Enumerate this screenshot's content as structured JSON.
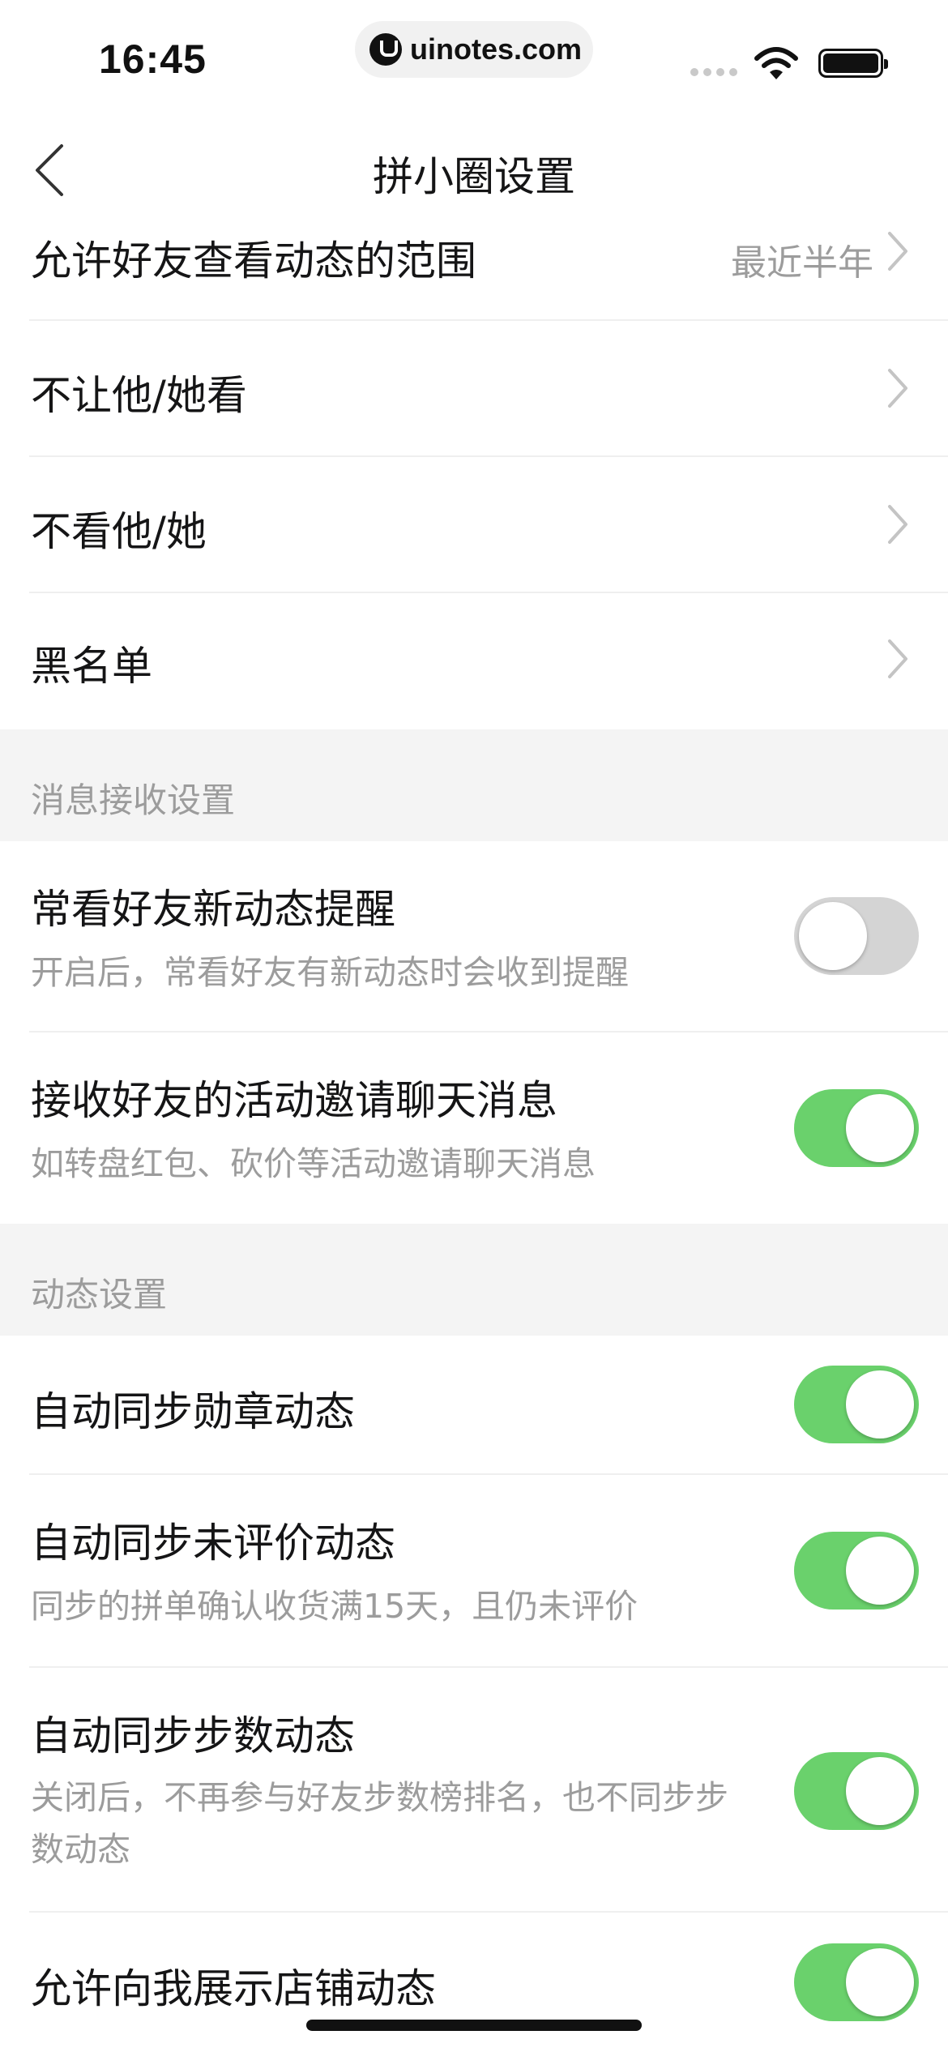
{
  "status_bar": {
    "time": "16:45",
    "url": "uinotes.com",
    "icons": [
      "cellular-signal-icon",
      "wifi-icon",
      "battery-icon"
    ]
  },
  "nav": {
    "title": "拼小圈设置",
    "back_icon": "chevron-left-icon"
  },
  "privacy_rows": [
    {
      "label": "允许好友查看动态的范围",
      "value": "最近半年"
    },
    {
      "label": "不让他/她看"
    },
    {
      "label": "不看他/她"
    },
    {
      "label": "黑名单"
    }
  ],
  "message_section": {
    "title": "消息接收设置",
    "items": [
      {
        "label": "常看好友新动态提醒",
        "desc": "开启后，常看好友有新动态时会收到提醒",
        "enabled": false
      },
      {
        "label": "接收好友的活动邀请聊天消息",
        "desc": "如转盘红包、砍价等活动邀请聊天消息",
        "enabled": true
      }
    ]
  },
  "moments_section": {
    "title": "动态设置",
    "items": [
      {
        "label": "自动同步勋章动态",
        "enabled": true
      },
      {
        "label": "自动同步未评价动态",
        "desc": "同步的拼单确认收货满15天，且仍未评价",
        "enabled": true
      },
      {
        "label": "自动同步步数动态",
        "desc": "关闭后，不再参与好友步数榜排名，也不同步步数动态",
        "enabled": true
      },
      {
        "label": "允许向我展示店铺动态",
        "enabled": true
      }
    ]
  },
  "colors": {
    "toggle_on": "#6ad16c",
    "toggle_off": "#d4d4d4",
    "section_bg": "#f4f4f4",
    "secondary_text": "#9c9c9c"
  }
}
